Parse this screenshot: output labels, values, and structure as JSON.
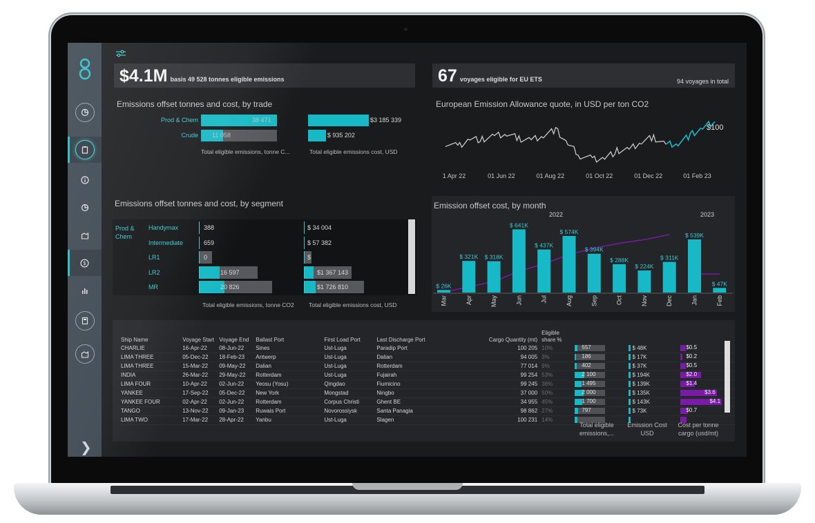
{
  "kpi_left": {
    "value": "$4.1M",
    "caption": "basis 49 528 tonnes eligible emissions"
  },
  "kpi_right": {
    "value": "67",
    "caption": "voyages eligible for EU ETS",
    "total": "94 voyages in total"
  },
  "trade": {
    "title": "Emissions offset tonnes and cost, by trade",
    "rows": [
      {
        "label": "Prod & Chem",
        "tonnes": 38471,
        "tonnes_label": "38 471",
        "cost": 3185339,
        "cost_label": "$3 185 339"
      },
      {
        "label": "Crude",
        "tonnes": 11058,
        "tonnes_label": "11 058",
        "cost": 935202,
        "cost_label": "$ 935 202"
      }
    ],
    "caption_tonnes": "Total eligible emissions, tonne C...",
    "caption_cost": "Total eligible emissions cost, USD"
  },
  "segment": {
    "title": "Emissions offset tonnes and cost, by segment",
    "group": "Prod & Chem",
    "rows": [
      {
        "label": "Handymax",
        "tonnes": 388,
        "tonnes_label": "388",
        "cost": 34004,
        "cost_label": "$ 34 004"
      },
      {
        "label": "Intermediate",
        "tonnes": 659,
        "tonnes_label": "659",
        "cost": 57382,
        "cost_label": "$ 57 382"
      },
      {
        "label": "LR1",
        "tonnes": 0,
        "tonnes_label": "0",
        "cost": 0,
        "cost_label": "$"
      },
      {
        "label": "LR2",
        "tonnes": 16597,
        "tonnes_label": "16 597",
        "cost": 1367143,
        "cost_label": "$1 367 143"
      },
      {
        "label": "MR",
        "tonnes": 20826,
        "tonnes_label": "20 826",
        "cost": 1726810,
        "cost_label": "$1 726 810"
      }
    ],
    "caption_tonnes": "Total eligible emissions, tonne CO2",
    "caption_cost": "Total eligible emissions cost, USD"
  },
  "colors": {
    "accent": "#17b9c6",
    "gray_bar": "#55585c",
    "purple": "#7a1aa8",
    "sidebar": "#3b4650",
    "panel": "#202225"
  },
  "chart_data": [
    {
      "type": "line",
      "title": "European Emission Allowance quote, in USD per ton CO2",
      "x": [
        "01 Apr 22",
        "15 Apr 22",
        "01 May 22",
        "15 May 22",
        "01 Jun 22",
        "15 Jun 22",
        "01 Jul 22",
        "15 Jul 22",
        "01 Aug 22",
        "15 Aug 22",
        "01 Sep 22",
        "15 Sep 22",
        "01 Oct 22",
        "15 Oct 22",
        "01 Nov 22",
        "15 Nov 22",
        "01 Dec 22",
        "15 Dec 22",
        "01 Jan 23",
        "15 Jan 23",
        "01 Feb 23",
        "15 Feb 23",
        "01 Mar 23"
      ],
      "values": [
        81,
        78,
        85,
        84,
        87,
        89,
        85,
        84,
        88,
        93,
        80,
        70,
        67,
        68,
        74,
        75,
        82,
        86,
        80,
        81,
        88,
        94,
        100
      ],
      "highlight_from_index": 18,
      "x_ticks": [
        "01 Apr 22",
        "01 Jun 22",
        "01 Aug 22",
        "01 Oct 22",
        "01 Dec 22",
        "01 Feb 23"
      ],
      "end_label": "$100"
    },
    {
      "type": "bar",
      "title": "Emission offset cost, by month",
      "year_labels": [
        "2022",
        "2023"
      ],
      "categories": [
        "Mar",
        "Apr",
        "May",
        "Jun",
        "Jul",
        "Aug",
        "Sep",
        "Oct",
        "Nov",
        "Dec",
        "Jan",
        "Feb"
      ],
      "values": [
        26,
        321,
        318,
        641,
        437,
        574,
        394,
        288,
        224,
        311,
        539,
        47
      ],
      "data_labels": [
        "$ 26K",
        "$ 321K",
        "$ 318K",
        "$ 641K",
        "$ 437K",
        "$ 574K",
        "$ 394K",
        "$ 288K",
        "$ 224K",
        "$ 311K",
        "$ 539K",
        "$ 47K"
      ],
      "ylim": [
        0,
        700
      ]
    }
  ],
  "table": {
    "headers": [
      "Ship Name",
      "Voyage Start",
      "Voyage End",
      "Ballast Port",
      "First Load Port",
      "Last Discharge Port",
      "Cargo Quantity (mt)",
      "Eligible share %",
      "",
      "",
      ""
    ],
    "rows": [
      {
        "ship": "CHARLIE",
        "start": "16-Apr-22",
        "end": "08-Jun-22",
        "ballast": "Sines",
        "load": "Ust-Luga",
        "discharge": "Paradip Port",
        "qty": "100 205",
        "share": "10%",
        "em": 557,
        "em_label": "557",
        "cost": 48,
        "cost_label": "$ 48K",
        "cpt": 0.5,
        "cpt_label": "$0.5"
      },
      {
        "ship": "LIMA THREE",
        "start": "05-Dec-22",
        "end": "18-Feb-23",
        "ballast": "Antwerp",
        "load": "Ust-Luga",
        "discharge": "Dalian",
        "qty": "94 005",
        "share": "3%",
        "em": 186,
        "em_label": "186",
        "cost": 17,
        "cost_label": "$ 17K",
        "cpt": 0.2,
        "cpt_label": "$0.2"
      },
      {
        "ship": "LIMA THREE",
        "start": "15-Mar-22",
        "end": "09-May-22",
        "ballast": "Dalian",
        "load": "Ust-Luga",
        "discharge": "Rotterdam",
        "qty": "77 014",
        "share": "9%",
        "em": 402,
        "em_label": "402",
        "cost": 37,
        "cost_label": "$ 37K",
        "cpt": 0.5,
        "cpt_label": "$0.5"
      },
      {
        "ship": "INDIA",
        "start": "26-Mar-22",
        "end": "29-May-22",
        "ballast": "Rotterdam",
        "load": "Ust-Luga",
        "discharge": "Fujairah",
        "qty": "99 254",
        "share": "53%",
        "em": 2100,
        "em_label": "2 100",
        "cost": 194,
        "cost_label": "$ 194K",
        "cpt": 2.0,
        "cpt_label": "$2.0"
      },
      {
        "ship": "LIMA FOUR",
        "start": "10-Apr-22",
        "end": "02-Jun-22",
        "ballast": "Yeosu (Yosu)",
        "load": "Qingdao",
        "discharge": "Fiumicino",
        "qty": "99 245",
        "share": "36%",
        "em": 1495,
        "em_label": "1 495",
        "cost": 139,
        "cost_label": "$ 139K",
        "cpt": 1.4,
        "cpt_label": "$1.4"
      },
      {
        "ship": "YANKEE",
        "start": "17-Sep-22",
        "end": "05-Dec-22",
        "ballast": "New York",
        "load": "Mongstad",
        "discharge": "Ningbo",
        "qty": "37 000",
        "share": "50%",
        "em": 2000,
        "em_label": "2 000",
        "cost": 135,
        "cost_label": "$ 135K",
        "cpt": 3.6,
        "cpt_label": "$3.6"
      },
      {
        "ship": "YANKEE FOUR",
        "start": "02-Apr-22",
        "end": "02-Jun-22",
        "ballast": "Rotterdam",
        "load": "Corpus Christi",
        "discharge": "Ghent BE",
        "qty": "34 955",
        "share": "45%",
        "em": 1700,
        "em_label": "1 700",
        "cost": 143,
        "cost_label": "$ 143K",
        "cpt": 4.1,
        "cpt_label": "$4.1"
      },
      {
        "ship": "TANGO",
        "start": "13-Nov-22",
        "end": "09-Jan-23",
        "ballast": "Ruwais Port",
        "load": "Novorossiysk",
        "discharge": "Santa Panagia",
        "qty": "98 862",
        "share": "27%",
        "em": 797,
        "em_label": "797",
        "cost": 73,
        "cost_label": "$ 73K",
        "cpt": 0.7,
        "cpt_label": "$0.7"
      },
      {
        "ship": "LIMA TWO",
        "start": "17-Mar-22",
        "end": "28-Apr-22",
        "ballast": "Yanbu",
        "load": "Ust-Luga",
        "discharge": "Slagen",
        "qty": "100 231",
        "share": "14%",
        "em": 640,
        "em_label": "",
        "cost": 60,
        "cost_label": "",
        "cpt": 0.6,
        "cpt_label": ""
      }
    ],
    "footer": {
      "emissions": "Total eligible emissions,...",
      "cost": "Emission Cost USD",
      "cpt": "Cost per tonne cargo (usd/mt)"
    }
  }
}
